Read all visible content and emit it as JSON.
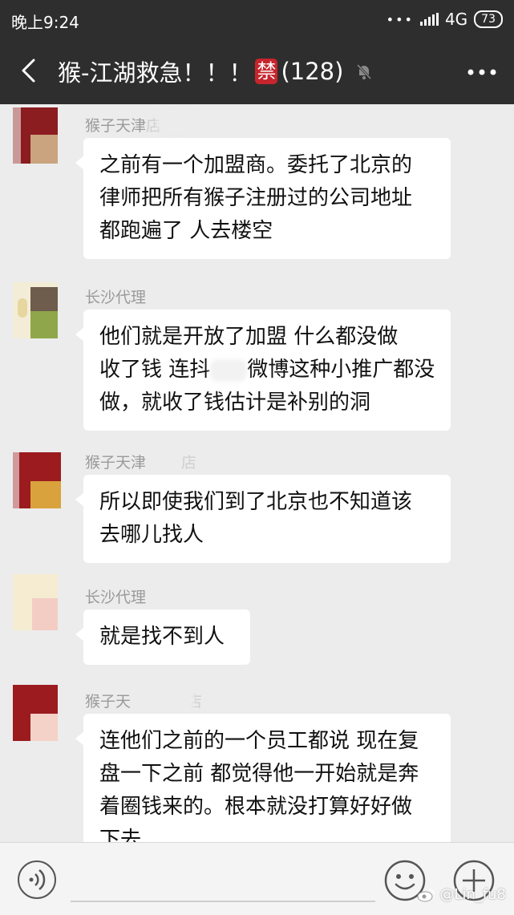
{
  "status_bar": {
    "time": "晚上9:24",
    "network": "4G",
    "battery": "73"
  },
  "header": {
    "title": "猴-江湖救急！！！",
    "ban_emoji": "禁",
    "member_count": "(128)"
  },
  "messages": [
    {
      "sender": "猴子天津",
      "sender_suffix": "店",
      "lines": [
        "之前有一个加盟商。委托了北京的",
        "律师把所有猴子注册过的公司地址",
        "都跑遍了 人去楼空"
      ]
    },
    {
      "sender": "长沙代理",
      "lines": [
        "他们就是开放了加盟  什么都没做",
        "收了钱 连抖",
        "微博这种小推广都没",
        "做，就收了钱估计是补别的洞"
      ]
    },
    {
      "sender": "猴子天津",
      "sender_suffix": "店",
      "lines": [
        "所以即使我们到了北京也不知道该",
        "去哪儿找人"
      ]
    },
    {
      "sender": "长沙代理",
      "lines": [
        "就是找不到人"
      ]
    },
    {
      "sender": "猴子天",
      "sender_suffix": "店",
      "lines": [
        "连他们之前的一个员工都说 现在复",
        "盘一下之前 都觉得他一开始就是奔",
        "着圈钱来的。根本就没打算好好做",
        "下去"
      ]
    }
  ],
  "watermark": "@Lin_fu8",
  "colors": {
    "header_bg": "#2e2e2e",
    "chat_bg": "#ececec",
    "ban_badge": "#c6252d"
  },
  "icons": [
    "back-arrow-icon",
    "mute-bell-icon",
    "more-dots-icon",
    "voice-icon",
    "emoji-icon",
    "plus-icon",
    "weibo-icon"
  ]
}
